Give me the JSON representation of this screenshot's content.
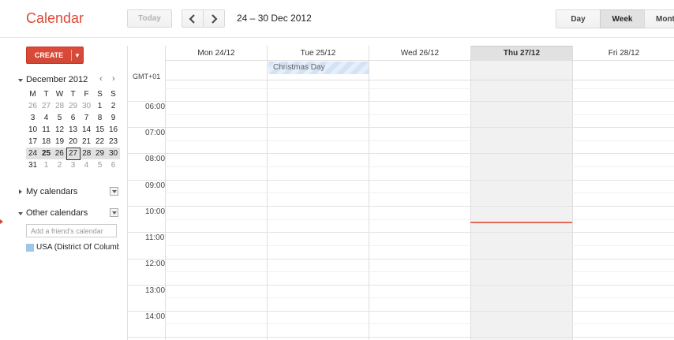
{
  "app": {
    "title": "Calendar"
  },
  "toolbar": {
    "today_label": "Today",
    "prev_icon": "chevron-left-icon",
    "next_icon": "chevron-right-icon",
    "date_range": "24 – 30 Dec 2012",
    "views": [
      "Day",
      "Week",
      "Month"
    ],
    "selected_view": "Week"
  },
  "sidebar": {
    "create_label": "CREATE",
    "mini_calendar": {
      "month_label": "December 2012",
      "weekdays": [
        "M",
        "T",
        "W",
        "T",
        "F",
        "S",
        "S"
      ],
      "weeks": [
        [
          "26",
          "27",
          "28",
          "29",
          "30",
          "1",
          "2"
        ],
        [
          "3",
          "4",
          "5",
          "6",
          "7",
          "8",
          "9"
        ],
        [
          "10",
          "11",
          "12",
          "13",
          "14",
          "15",
          "16"
        ],
        [
          "17",
          "18",
          "19",
          "20",
          "21",
          "22",
          "23"
        ],
        [
          "24",
          "25",
          "26",
          "27",
          "28",
          "29",
          "30"
        ],
        [
          "31",
          "1",
          "2",
          "3",
          "4",
          "5",
          "6"
        ]
      ],
      "today": "27"
    },
    "my_calendars_label": "My calendars",
    "other_calendars_label": "Other calendars",
    "friend_placeholder": "Add a friend's calendar",
    "calendars": [
      {
        "name": "USA (District Of Columbia)",
        "color": "#9fc6e7"
      }
    ]
  },
  "week": {
    "timezone": "GMT+01",
    "days": [
      "Mon 24/12",
      "Tue 25/12",
      "Wed 26/12",
      "Thu 27/12",
      "Fri 28/12"
    ],
    "today_day": "Thu 27/12",
    "all_day_events": [
      {
        "day": "Tue 25/12",
        "title": "Christmas Day"
      }
    ],
    "hours": [
      "06:00",
      "07:00",
      "08:00",
      "09:00",
      "10:00",
      "11:00",
      "12:00",
      "13:00",
      "14:00"
    ]
  },
  "colors": {
    "brand": "#dd4b39",
    "now_line": "#e46c5a",
    "event_bg": "#d3e3f5"
  }
}
